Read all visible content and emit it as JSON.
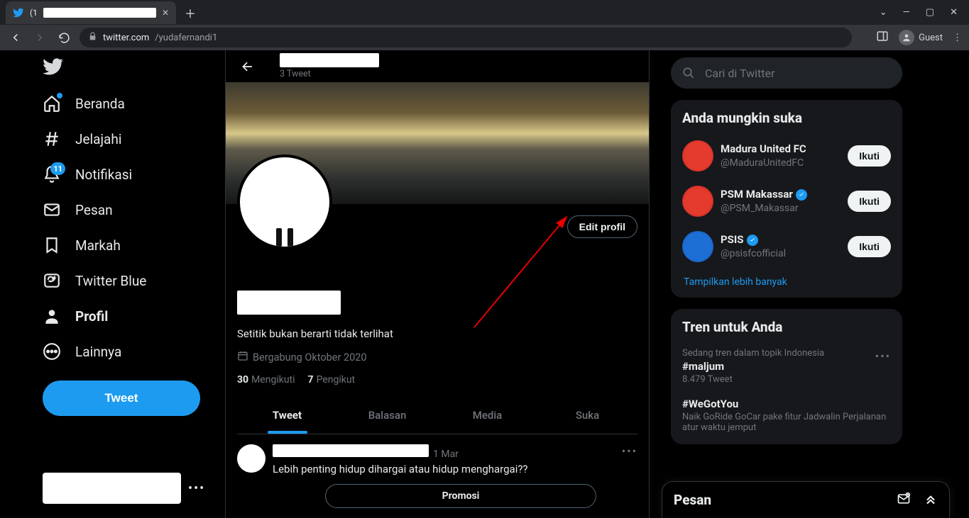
{
  "browser": {
    "tab_prefix": "(1",
    "url_host": "twitter.com",
    "url_path": "/yudafernandi1",
    "guest_label": "Guest"
  },
  "nav": {
    "items": [
      {
        "label": "Beranda"
      },
      {
        "label": "Jelajahi"
      },
      {
        "label": "Notifikasi",
        "badge": "11"
      },
      {
        "label": "Pesan"
      },
      {
        "label": "Markah"
      },
      {
        "label": "Twitter Blue"
      },
      {
        "label": "Profil"
      },
      {
        "label": "Lainnya"
      }
    ],
    "tweet_button": "Tweet"
  },
  "profile": {
    "header_tweet_count": "3 Tweet",
    "edit_button": "Edit profil",
    "bio": "Setitik bukan berarti tidak terlihat",
    "joined": "Bergabung Oktober 2020",
    "following_count": "30",
    "following_label": "Mengikuti",
    "followers_count": "7",
    "followers_label": "Pengikut",
    "tabs": [
      "Tweet",
      "Balasan",
      "Media",
      "Suka"
    ]
  },
  "tweet": {
    "time": "1 Mar",
    "text": "Lebih penting hidup dihargai atau hidup menghargai??",
    "promote": "Promosi"
  },
  "search": {
    "placeholder": "Cari di Twitter"
  },
  "who_to_follow": {
    "title": "Anda mungkin suka",
    "items": [
      {
        "name": "Madura United FC",
        "handle": "@MaduraUnitedFC",
        "verified": false
      },
      {
        "name": "PSM Makassar",
        "handle": "@PSM_Makassar",
        "verified": true
      },
      {
        "name": "PSIS",
        "handle": "@psisfcofficial",
        "verified": true
      }
    ],
    "follow_label": "Ikuti",
    "show_more": "Tampilkan lebih banyak"
  },
  "trends": {
    "title": "Tren untuk Anda",
    "items": [
      {
        "meta": "Sedang tren dalam topik Indonesia",
        "tag": "#maljum",
        "count": "8.479 Tweet"
      },
      {
        "meta": "",
        "tag": "#WeGotYou",
        "count": "Naik GoRide GoCar pake fitur Jadwalin Perjalanan atur waktu jemput"
      }
    ]
  },
  "dock": {
    "title": "Pesan"
  }
}
